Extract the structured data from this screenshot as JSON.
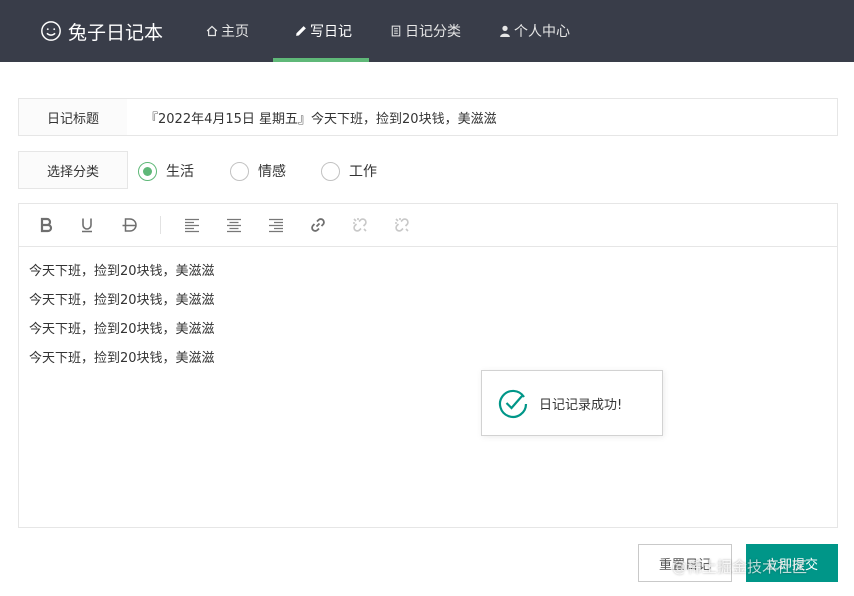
{
  "header": {
    "brand": "兔子日记本",
    "nav": [
      {
        "label": "主页"
      },
      {
        "label": "写日记"
      },
      {
        "label": "日记分类"
      },
      {
        "label": "个人中心"
      }
    ],
    "active_index": 1
  },
  "form": {
    "title_label": "日记标题",
    "title_value": "『2022年4月15日 星期五』今天下班，捡到20块钱，美滋滋",
    "category_label": "选择分类",
    "categories": [
      "生活",
      "情感",
      "工作"
    ],
    "selected_category": "生活"
  },
  "editor": {
    "tools": [
      "bold-icon",
      "underline-icon",
      "strikethrough-icon",
      "align-left-icon",
      "align-center-icon",
      "align-right-icon",
      "link-icon",
      "unlink-icon",
      "unlink-icon"
    ],
    "lines": [
      "今天下班，捡到20块钱，美滋滋",
      "今天下班，捡到20块钱，美滋滋",
      "今天下班，捡到20块钱，美滋滋",
      "今天下班，捡到20块钱，美滋滋"
    ]
  },
  "toast": {
    "message": "日记记录成功!",
    "icon": "check-circle-icon"
  },
  "buttons": {
    "reset": "重置日记",
    "submit": "立即提交"
  },
  "watermark": "@稀土掘金技术社区",
  "colors": {
    "header_bg": "#393d49",
    "accent_green": "#5fb878",
    "submit_bg": "#009688"
  }
}
